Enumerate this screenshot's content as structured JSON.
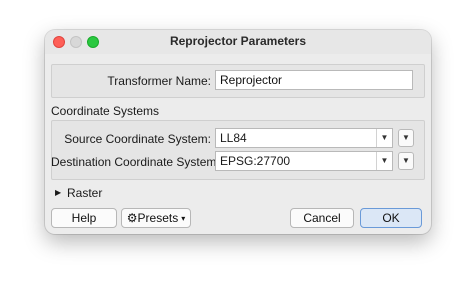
{
  "window": {
    "title": "Reprojector Parameters"
  },
  "transformer": {
    "label": "Transformer Name:",
    "value": "Reprojector"
  },
  "coordinate_systems": {
    "heading": "Coordinate Systems",
    "source_label": "Source Coordinate System:",
    "source_value": "LL84",
    "destination_label": "Destination Coordinate System:",
    "destination_value": "EPSG:27700"
  },
  "raster": {
    "label": "Raster",
    "icon": "triangle-right-icon"
  },
  "buttons": {
    "help": "Help",
    "presets": "Presets",
    "cancel": "Cancel",
    "ok": "OK"
  },
  "icons": {
    "close": "close-icon",
    "minimize": "minimize-icon",
    "maximize": "maximize-icon",
    "dropdown": "chevron-down-icon",
    "presets": "gear-icon"
  },
  "colors": {
    "close": "#fe5f57",
    "maximize": "#2ac840",
    "default_button": "#dbe7f6"
  }
}
